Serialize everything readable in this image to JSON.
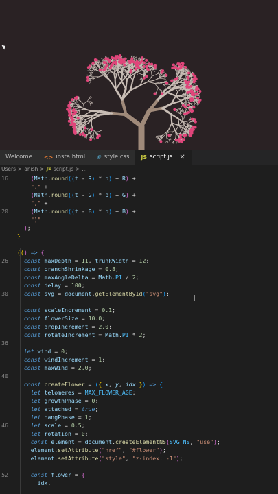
{
  "tabs": [
    {
      "label": "Welcome",
      "icon": "",
      "active": false
    },
    {
      "label": "insta.html",
      "icon": "html-file-icon",
      "active": false
    },
    {
      "label": "style.css",
      "icon": "css-file-icon",
      "active": false
    },
    {
      "label": "script.js",
      "icon": "js-file-icon",
      "active": true
    }
  ],
  "tab_glyphs": {
    "html": "<>",
    "css": "#",
    "js": "JS",
    "close": "✕"
  },
  "breadcrumb": [
    "Users",
    "anish",
    "script.js",
    "..."
  ],
  "breadcrumb_sep": ">",
  "code_lines": [
    {
      "n": "16",
      "html": "    <span class='par2'>(</span><span class='var'>Math</span>.<span class='fn'>round</span><span class='par3'>((</span><span class='var'>t</span> <span class='op'>-</span> <span class='var'>R</span><span class='par3'>)</span> <span class='op'>*</span> <span class='var'>p</span><span class='par3'>)</span> <span class='op'>+</span> <span class='var'>R</span><span class='par2'>)</span> <span class='op'>+</span>"
    },
    {
      "n": "",
      "html": "    <span class='str'>\",\"</span> <span class='op'>+</span>"
    },
    {
      "n": "",
      "html": "    <span class='par2'>(</span><span class='var'>Math</span>.<span class='fn'>round</span><span class='par3'>((</span><span class='var'>t</span> <span class='op'>-</span> <span class='var'>G</span><span class='par3'>)</span> <span class='op'>*</span> <span class='var'>p</span><span class='par3'>)</span> <span class='op'>+</span> <span class='var'>G</span><span class='par2'>)</span> <span class='op'>+</span>"
    },
    {
      "n": "",
      "html": "    <span class='str'>\",\"</span> <span class='op'>+</span>"
    },
    {
      "n": "20",
      "html": "    <span class='par2'>(</span><span class='var'>Math</span>.<span class='fn'>round</span><span class='par3'>((</span><span class='var'>t</span> <span class='op'>-</span> <span class='var'>B</span><span class='par3'>)</span> <span class='op'>*</span> <span class='var'>p</span><span class='par3'>)</span> <span class='op'>+</span> <span class='var'>B</span><span class='par2'>)</span> <span class='op'>+</span>"
    },
    {
      "n": "",
      "html": "    <span class='str'>\")\"</span>"
    },
    {
      "n": "",
      "html": "  <span class='par2'>)</span>;"
    },
    {
      "n": "",
      "html": "<span class='par'>}</span>"
    },
    {
      "n": "",
      "html": ""
    },
    {
      "n": "",
      "html": "<span class='par'>((</span><span class='par2'>)</span> <span class='kw'>=&gt;</span> <span class='par2'>{</span>"
    },
    {
      "n": "26",
      "html": "  <span class='kw'>const</span> <span class='var'>maxDepth</span> <span class='op'>=</span> <span class='num'>11</span>, <span class='var'>trunkWidth</span> <span class='op'>=</span> <span class='num'>12</span>;"
    },
    {
      "n": "",
      "html": "  <span class='kw'>const</span> <span class='var'>branchShrinkage</span> <span class='op'>=</span> <span class='num'>0.8</span>;"
    },
    {
      "n": "",
      "html": "  <span class='kw'>const</span> <span class='var'>maxAngleDelta</span> <span class='op'>=</span> <span class='var'>Math</span>.<span class='cst'>PI</span> <span class='op'>/</span> <span class='num'>2</span>;"
    },
    {
      "n": "",
      "html": "  <span class='kw'>const</span> <span class='var'>delay</span> <span class='op'>=</span> <span class='num'>100</span>;"
    },
    {
      "n": "30",
      "html": "  <span class='kw'>const</span> <span class='var'>svg</span> <span class='op'>=</span> <span class='var'>document</span>.<span class='fn'>getElementById</span><span class='par3'>(</span><span class='str'>\"svg\"</span><span class='par3'>)</span>;"
    },
    {
      "n": "",
      "html": ""
    },
    {
      "n": "",
      "html": "  <span class='kw'>const</span> <span class='var'>scaleIncrement</span> <span class='op'>=</span> <span class='num'>0.1</span>;"
    },
    {
      "n": "",
      "html": "  <span class='kw'>const</span> <span class='var'>flowerSize</span> <span class='op'>=</span> <span class='num'>10.0</span>;"
    },
    {
      "n": "",
      "html": "  <span class='kw'>const</span> <span class='var'>dropIncrement</span> <span class='op'>=</span> <span class='num'>2.0</span>;"
    },
    {
      "n": "",
      "html": "  <span class='kw'>const</span> <span class='var'>rotateIncrement</span> <span class='op'>=</span> <span class='var'>Math</span>.<span class='cst'>PI</span> <span class='op'>*</span> <span class='num'>2</span>;"
    },
    {
      "n": "36",
      "html": ""
    },
    {
      "n": "",
      "html": "  <span class='kw'>let</span> <span class='var'>wind</span> <span class='op'>=</span> <span class='num'>0</span>;"
    },
    {
      "n": "",
      "html": "  <span class='kw'>const</span> <span class='var'>windIncrement</span> <span class='op'>=</span> <span class='num'>1</span>;"
    },
    {
      "n": "",
      "html": "  <span class='kw'>const</span> <span class='var'>maxWind</span> <span class='op'>=</span> <span class='num'>2.0</span>;"
    },
    {
      "n": "40",
      "html": ""
    },
    {
      "n": "",
      "html": "  <span class='kw'>const</span> <span class='fn'>createFlower</span> <span class='op'>=</span> <span class='par3'>(</span><span class='par'>{</span> <span class='var' style='font-style:italic'>x</span>, <span class='var' style='font-style:italic'>y</span>, <span class='var' style='font-style:italic'>idx</span> <span class='par'>}</span><span class='par3'>)</span> <span class='kw'>=&gt;</span> <span class='par3'>{</span>"
    },
    {
      "n": "",
      "html": "    <span class='kw'>let</span> <span class='var'>telomeres</span> <span class='op'>=</span> <span class='cst'>MAX_FLOWER_AGE</span>;"
    },
    {
      "n": "",
      "html": "    <span class='kw'>let</span> <span class='var'>growthPhase</span> <span class='op'>=</span> <span class='num'>0</span>;"
    },
    {
      "n": "",
      "html": "    <span class='kw'>let</span> <span class='var'>attached</span> <span class='op'>=</span> <span class='kw'>true</span>;"
    },
    {
      "n": "",
      "html": "    <span class='kw'>let</span> <span class='var'>hangPhase</span> <span class='op'>=</span> <span class='num'>1</span>;"
    },
    {
      "n": "46",
      "html": "    <span class='kw'>let</span> <span class='var'>scale</span> <span class='op'>=</span> <span class='num'>0.5</span>;"
    },
    {
      "n": "",
      "html": "    <span class='kw'>let</span> <span class='var'>rotation</span> <span class='op'>=</span> <span class='num'>0</span>;"
    },
    {
      "n": "",
      "html": "    <span class='kw'>const</span> <span class='var'>element</span> <span class='op'>=</span> <span class='var'>document</span>.<span class='fn'>createElementNS</span><span class='par2'>(</span><span class='cst'>SVG_NS</span>, <span class='str'>\"use\"</span><span class='par2'>)</span>;"
    },
    {
      "n": "",
      "html": "    <span class='var'>element</span>.<span class='fn'>setAttribute</span><span class='par2'>(</span><span class='str'>\"href\"</span>, <span class='str'>\"#flower\"</span><span class='par2'>)</span>;"
    },
    {
      "n": "",
      "html": "    <span class='var'>element</span>.<span class='fn'>setAttribute</span><span class='par2'>(</span><span class='str'>\"style\"</span>, <span class='str'>\"z-index: -1\"</span><span class='par2'>)</span>;"
    },
    {
      "n": "",
      "html": ""
    },
    {
      "n": "52",
      "html": "    <span class='kw'>const</span> <span class='var'>flower</span> <span class='op'>=</span> <span class='par2'>{</span>"
    },
    {
      "n": "",
      "html": "      <span class='var'>idx</span>,"
    },
    {
      "n": "",
      "html": ""
    }
  ],
  "colors": {
    "preview_bg": "#2a2224",
    "trunk": "#a08a7a",
    "branch": "#c8bdb5",
    "flower": "#e0457a",
    "editor_bg": "#1e1e1e"
  }
}
